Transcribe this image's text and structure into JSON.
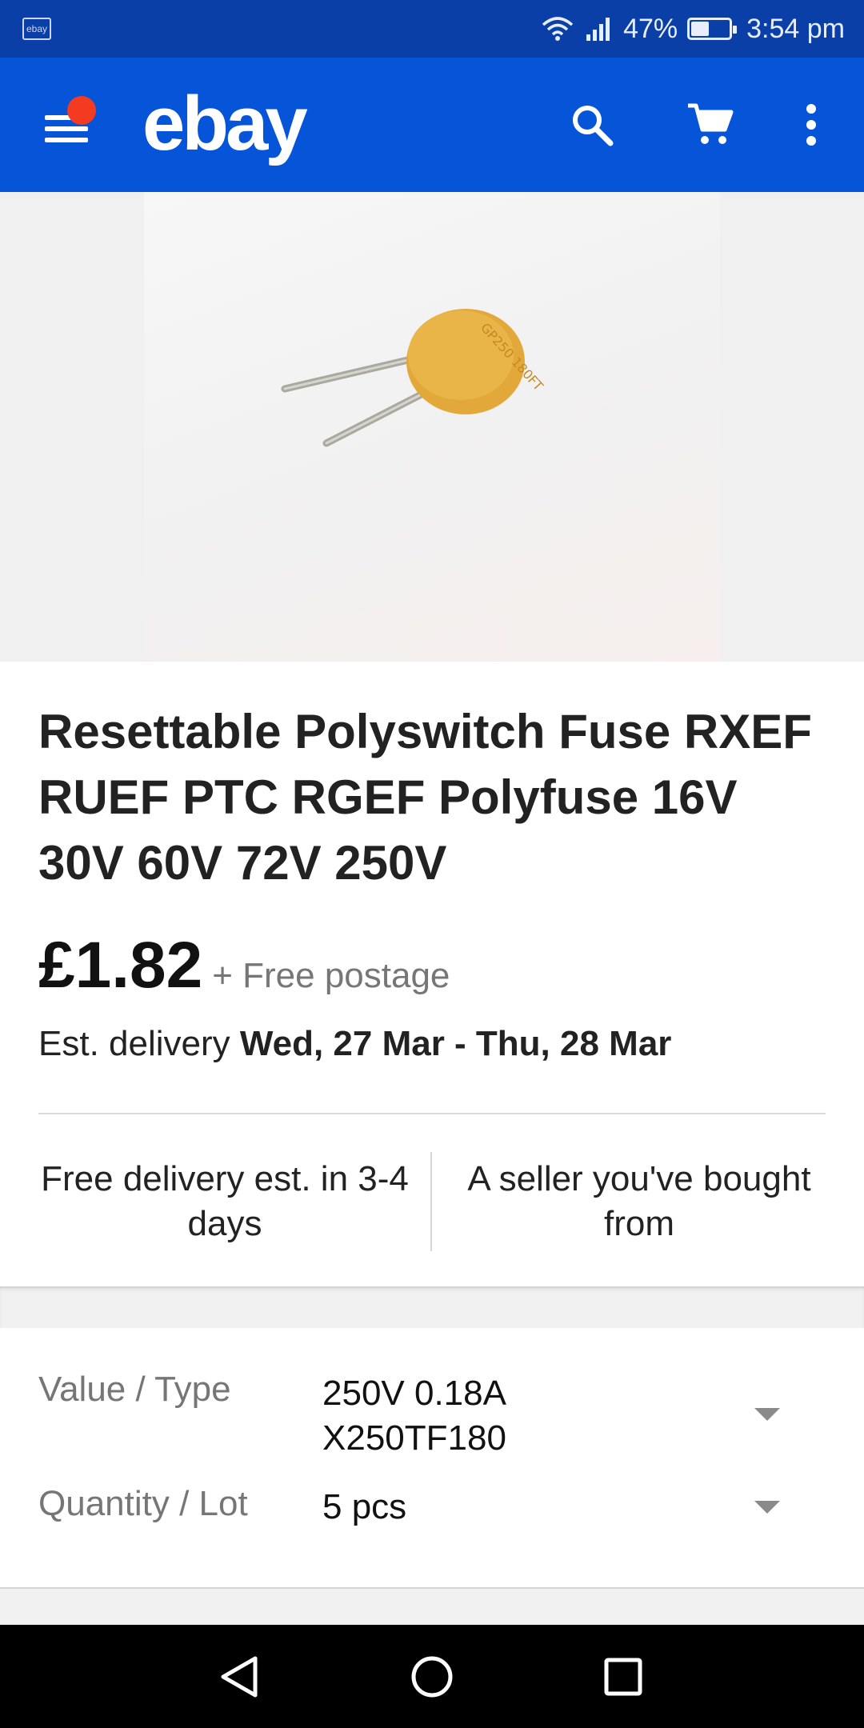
{
  "status_bar": {
    "app_icon_text": "ebay",
    "battery_percent": "47%",
    "battery_level": 0.47,
    "time": "3:54 pm",
    "icons": [
      "wifi-icon",
      "signal-icon",
      "battery-icon"
    ]
  },
  "app_bar": {
    "logo": "ebay",
    "background": "#0654d8",
    "notification_dot_color": "#f23b20",
    "icons": [
      "menu-icon",
      "search-icon",
      "cart-icon",
      "more-vert-icon"
    ]
  },
  "product": {
    "image_label": "GP250 180FT",
    "title": "Resettable Polyswitch Fuse RXEF RUEF PTC RGEF Polyfuse 16V 30V 60V 72V 250V",
    "price": "£1.82",
    "postage": "+ Free postage",
    "delivery_prefix": "Est. delivery ",
    "delivery_dates": "Wed, 27 Mar - Thu, 28 Mar"
  },
  "features": {
    "left": "Free delivery est. in 3-4 days",
    "right": "A seller you've bought from"
  },
  "options": [
    {
      "label": "Value / Type",
      "value": "250V 0.18A X250TF180"
    },
    {
      "label": "Quantity / Lot",
      "value": "5 pcs"
    }
  ],
  "nav_bar": {
    "icons": [
      "back-icon",
      "home-icon",
      "recents-icon"
    ]
  }
}
